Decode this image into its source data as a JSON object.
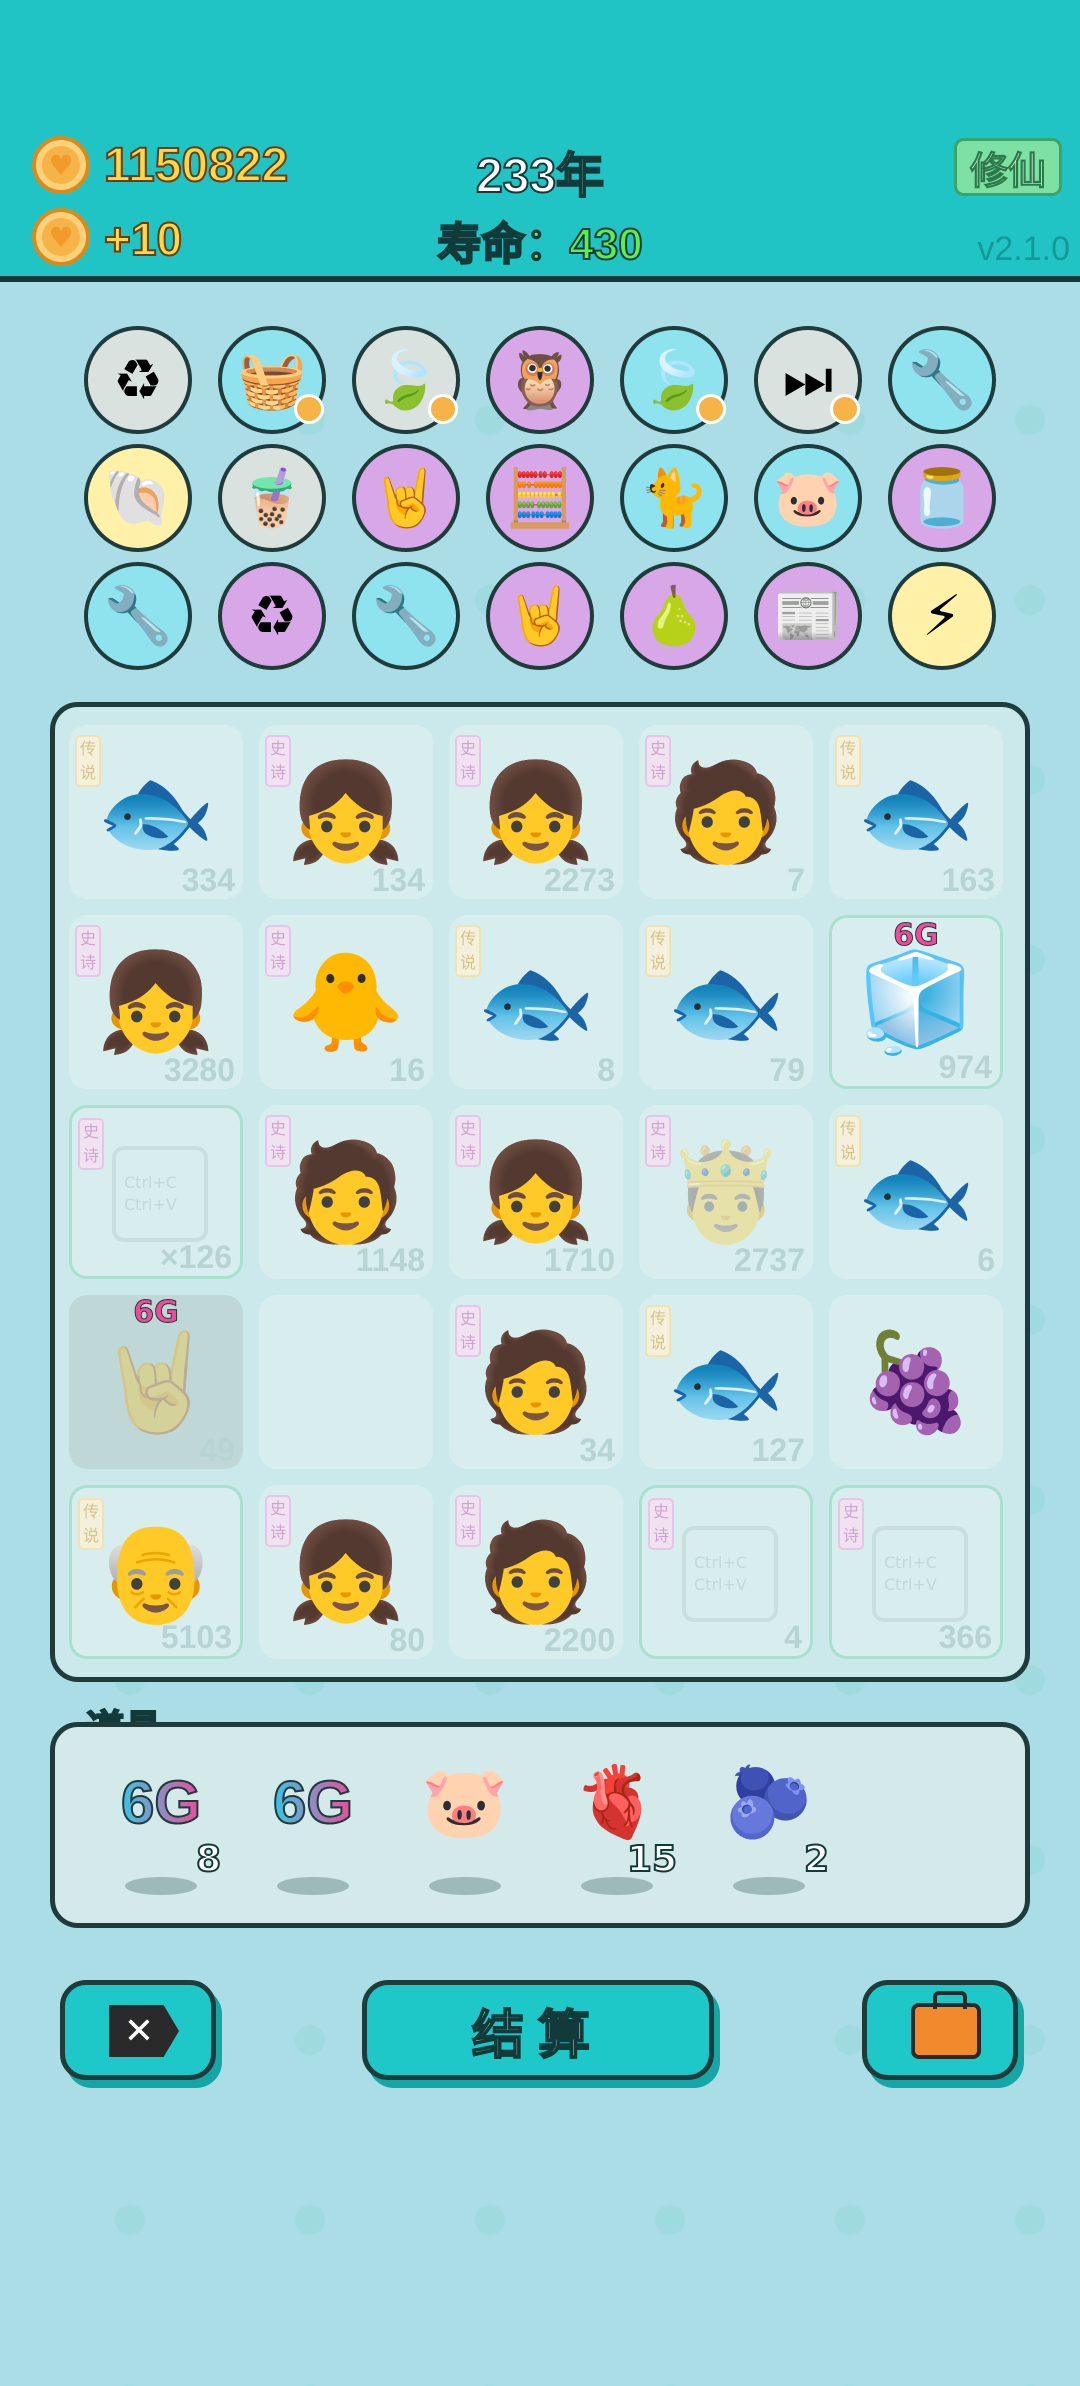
{
  "header": {
    "coins": "1150822",
    "coin_rate": "+10",
    "year": "233年",
    "lifespan": "寿命：430",
    "cultivate_button": "修仙",
    "version": "v2.1.0"
  },
  "shop_icons": [
    {
      "name": "refresh-icon",
      "glyph": "♻"
    },
    {
      "name": "fruit-basket-icon",
      "glyph": "🧺"
    },
    {
      "name": "leaf-icon",
      "glyph": "🍃"
    },
    {
      "name": "owl-icon",
      "glyph": "🦉"
    },
    {
      "name": "leaf-icon",
      "glyph": "🍃"
    },
    {
      "name": "skip-icon",
      "glyph": "⏭"
    },
    {
      "name": "pump-icon",
      "glyph": "🔧"
    },
    {
      "name": "shell-icon",
      "glyph": "🐚"
    },
    {
      "name": "bubble-tea-icon",
      "glyph": "🧋"
    },
    {
      "name": "rock-hand-icon",
      "glyph": "🤘"
    },
    {
      "name": "math-head-icon",
      "glyph": "🧮"
    },
    {
      "name": "cat-icon",
      "glyph": "🐈"
    },
    {
      "name": "piggy-bank-icon",
      "glyph": "🐷"
    },
    {
      "name": "jar-icon",
      "glyph": "🫙"
    },
    {
      "name": "pump-icon",
      "glyph": "🔧"
    },
    {
      "name": "recycle-icon",
      "glyph": "♻"
    },
    {
      "name": "pump-icon",
      "glyph": "🔧"
    },
    {
      "name": "rock-hand-icon",
      "glyph": "🤘"
    },
    {
      "name": "pomelo-icon",
      "glyph": "🍐"
    },
    {
      "name": "time-magazine-icon",
      "glyph": "📰"
    },
    {
      "name": "lightning-icon",
      "glyph": "⚡"
    }
  ],
  "board": [
    {
      "tag": "传说",
      "emoji": "🐟",
      "num": "334"
    },
    {
      "tag": "史诗",
      "emoji": "👧",
      "num": "134"
    },
    {
      "tag": "史诗",
      "emoji": "👧",
      "num": "2273"
    },
    {
      "tag": "史诗",
      "emoji": "🧑",
      "num": "7"
    },
    {
      "tag": "传说",
      "emoji": "🐟",
      "num": "163"
    },
    {
      "tag": "史诗",
      "emoji": "👧",
      "num": "3280"
    },
    {
      "tag": "史诗",
      "emoji": "🐥",
      "num": "16"
    },
    {
      "tag": "传说",
      "emoji": "🐟",
      "num": "8"
    },
    {
      "tag": "传说",
      "emoji": "🐟",
      "num": "79"
    },
    {
      "tag": "",
      "emoji": "🧊",
      "num": "974",
      "label": "6G"
    },
    {
      "tag": "史诗",
      "emoji": "",
      "num": "×126",
      "copy": "Ctrl+C Ctrl+V"
    },
    {
      "tag": "史诗",
      "emoji": "🧑",
      "num": "1148"
    },
    {
      "tag": "史诗",
      "emoji": "👧",
      "num": "1710"
    },
    {
      "tag": "史诗",
      "emoji": "🤴",
      "num": "2737"
    },
    {
      "tag": "传说",
      "emoji": "🐟",
      "num": "6"
    },
    {
      "tag": "",
      "emoji": "🤘",
      "num": "49",
      "label": "6G"
    },
    {
      "tag": "",
      "emoji": "",
      "num": ""
    },
    {
      "tag": "史诗",
      "emoji": "🧑",
      "num": "34"
    },
    {
      "tag": "传说",
      "emoji": "🐟",
      "num": "127"
    },
    {
      "tag": "",
      "emoji": "🍇",
      "num": ""
    },
    {
      "tag": "传说",
      "emoji": "👴",
      "num": "5103"
    },
    {
      "tag": "史诗",
      "emoji": "👧",
      "num": "80"
    },
    {
      "tag": "史诗",
      "emoji": "🧑",
      "num": "2200"
    },
    {
      "tag": "史诗",
      "emoji": "",
      "num": "4",
      "copy": "Ctrl+C Ctrl+V"
    },
    {
      "tag": "史诗",
      "emoji": "",
      "num": "366",
      "copy": "Ctrl+C Ctrl+V"
    }
  ],
  "items": {
    "label": "道具",
    "list": [
      {
        "text": "6G",
        "count": "8"
      },
      {
        "text": "6G",
        "count": ""
      },
      {
        "glyph": "🐷",
        "count": ""
      },
      {
        "glyph": "🫀",
        "count": "15"
      },
      {
        "glyph": "🫐",
        "count": "2"
      }
    ]
  },
  "buttons": {
    "close": "✕",
    "settle": "结算"
  }
}
